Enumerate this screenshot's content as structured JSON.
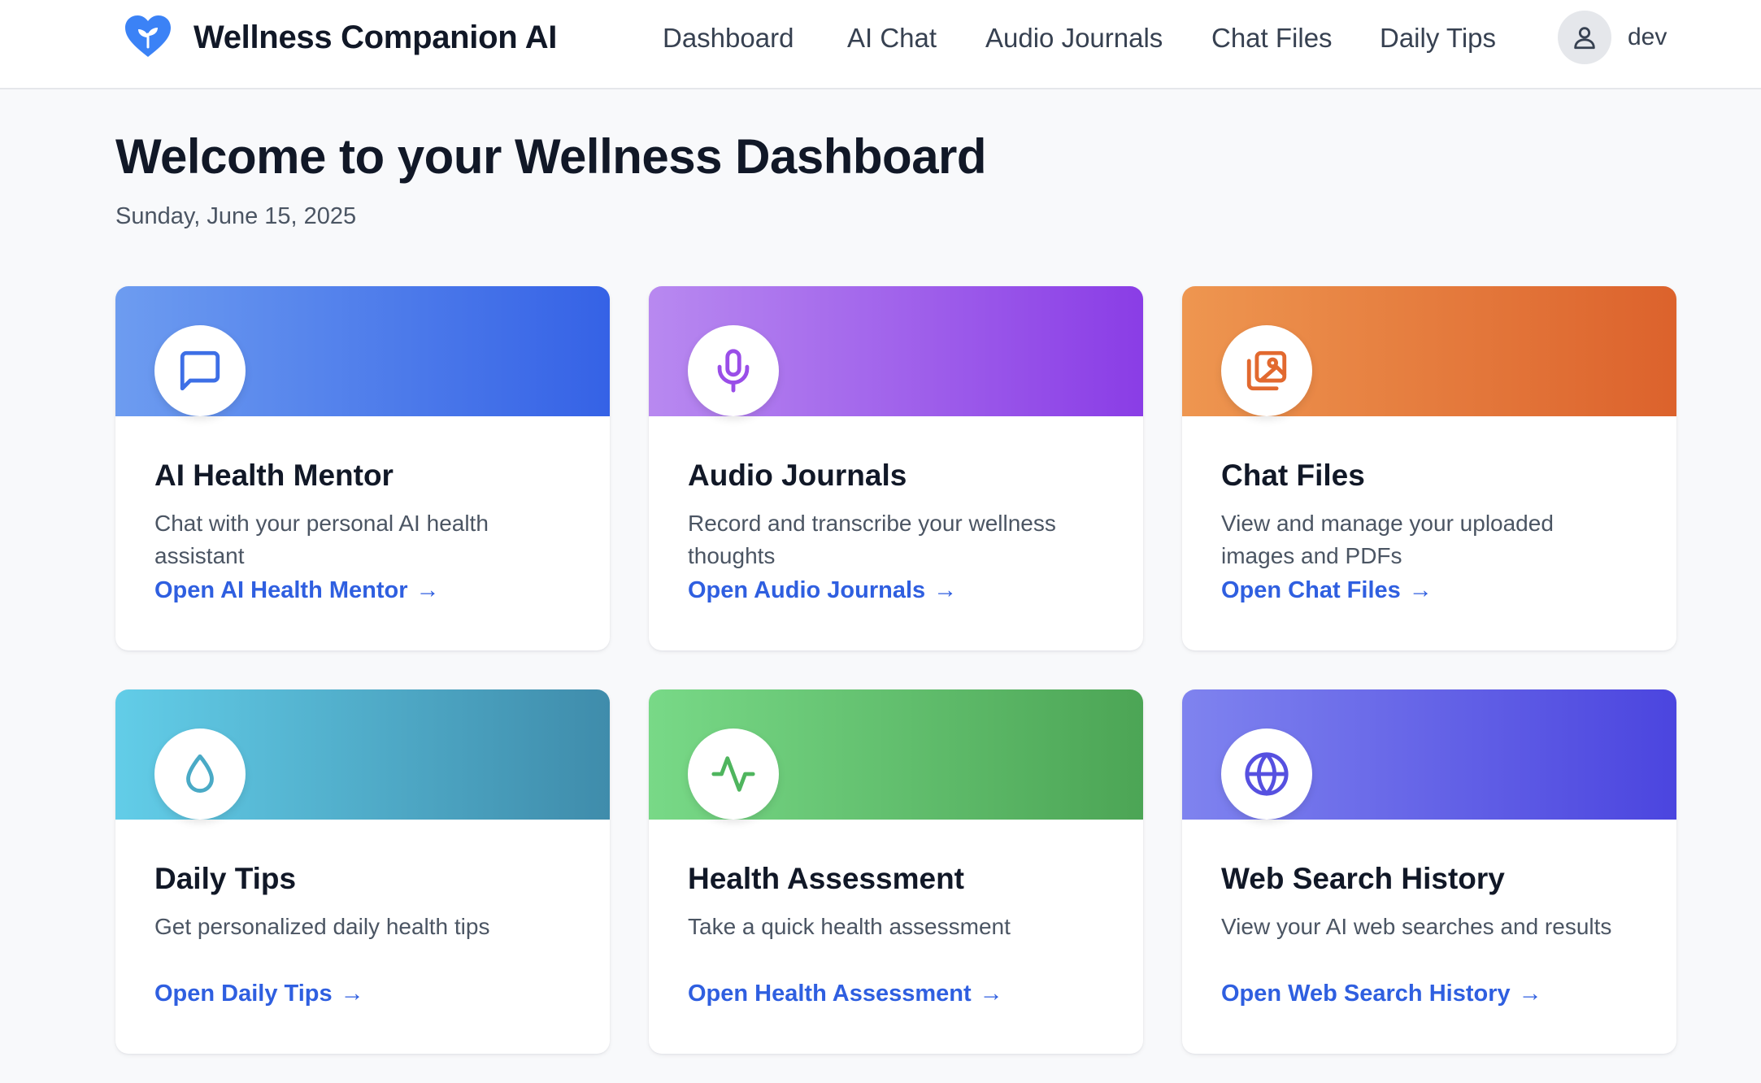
{
  "header": {
    "brand_name": "Wellness Companion AI",
    "logo_icon": "heart-sprout-icon",
    "nav": [
      {
        "label": "Dashboard"
      },
      {
        "label": "AI Chat"
      },
      {
        "label": "Audio Journals"
      },
      {
        "label": "Chat Files"
      },
      {
        "label": "Daily Tips"
      }
    ],
    "user": {
      "name": "dev",
      "icon": "user-icon"
    }
  },
  "page": {
    "title": "Welcome to your Wellness Dashboard",
    "date": "Sunday, June 15, 2025"
  },
  "cards": [
    {
      "title": "AI Health Mentor",
      "description": "Chat with your personal AI health assistant",
      "link": "Open AI Health Mentor",
      "arrow": "→",
      "icon": "message-square-icon",
      "gradient": [
        "#6d9cf0",
        "#3562e6"
      ],
      "icon_color": "#3d6fe6"
    },
    {
      "title": "Audio Journals",
      "description": "Record and transcribe your wellness thoughts",
      "link": "Open Audio Journals",
      "arrow": "→",
      "icon": "microphone-icon",
      "gradient": [
        "#b889f0",
        "#8a3de6"
      ],
      "icon_color": "#9a4ee8"
    },
    {
      "title": "Chat Files",
      "description": "View and manage your uploaded images and PDFs",
      "link": "Open Chat Files",
      "arrow": "→",
      "icon": "images-icon",
      "gradient": [
        "#ee9650",
        "#dc622c"
      ],
      "icon_color": "#e2692f"
    },
    {
      "title": "Daily Tips",
      "description": "Get personalized daily health tips",
      "link": "Open Daily Tips",
      "arrow": "→",
      "icon": "droplet-icon",
      "gradient": [
        "#62cde8",
        "#3f8cab"
      ],
      "icon_color": "#4aaac6"
    },
    {
      "title": "Health Assessment",
      "description": "Take a quick health assessment",
      "link": "Open Health Assessment",
      "arrow": "→",
      "icon": "activity-icon",
      "gradient": [
        "#78d987",
        "#4ca555"
      ],
      "icon_color": "#4fb55e"
    },
    {
      "title": "Web Search History",
      "description": "View your AI web searches and results",
      "link": "Open Web Search History",
      "arrow": "→",
      "icon": "globe-icon",
      "gradient": [
        "#7f83ef",
        "#4b45df"
      ],
      "icon_color": "#5650e0"
    }
  ]
}
